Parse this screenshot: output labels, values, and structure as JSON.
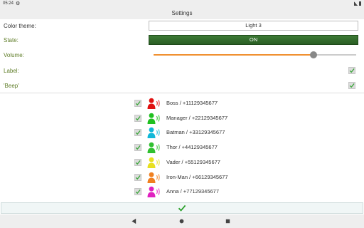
{
  "status_bar": {
    "time": "05:24",
    "left_icon": "gear-icon"
  },
  "header": {
    "title": "Settings"
  },
  "settings": {
    "color_theme": {
      "label": "Color theme:",
      "value": "Light 3"
    },
    "state": {
      "label": "State:",
      "value": "ON"
    },
    "volume": {
      "label": "Volume:",
      "level_fraction": 0.79
    },
    "label_opt": {
      "label": "Label:",
      "checked": true
    },
    "beep_opt": {
      "label": "'Beep'",
      "checked": true
    }
  },
  "contacts": [
    {
      "text": "Boss / +11129345677",
      "color": "#e01010",
      "checked": true
    },
    {
      "text": "Manager / +22129345677",
      "color": "#20c020",
      "checked": true
    },
    {
      "text": "Batman / +33129345677",
      "color": "#10b8d8",
      "checked": true
    },
    {
      "text": "Thor / +44129345677",
      "color": "#30c030",
      "checked": true
    },
    {
      "text": "Vader / +55129345677",
      "color": "#e8e020",
      "checked": true
    },
    {
      "text": "Iron-Man / +66129345677",
      "color": "#f08020",
      "checked": true
    },
    {
      "text": "Anna / +77129345677",
      "color": "#e020c0",
      "checked": true
    }
  ],
  "colors": {
    "accent_green": "#2f6a28",
    "slider_orange": "#f09030",
    "check_green": "#3aa53a",
    "label_green": "#5f7d28"
  },
  "icons": {
    "confirm": "check-icon",
    "nav_back": "back-triangle-icon",
    "nav_home": "home-circle-icon",
    "nav_recent": "recent-square-icon"
  }
}
